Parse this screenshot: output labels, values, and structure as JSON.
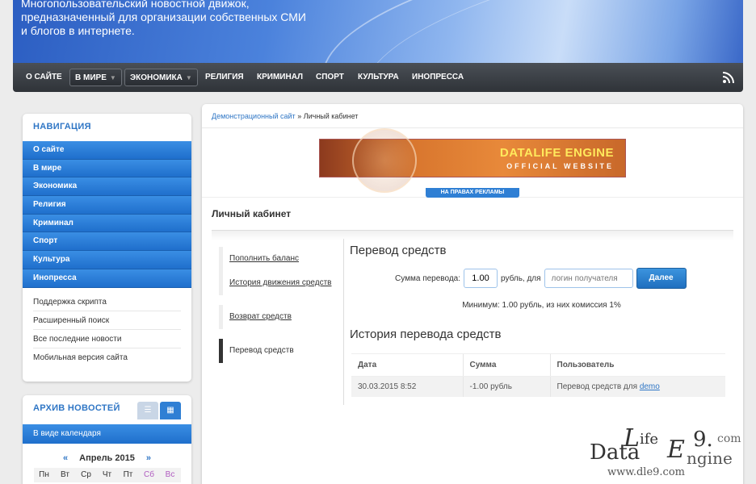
{
  "header": {
    "desc": "Многопользовательский новостной движок, предназначенный для организации собственных СМИ и блогов в интернете."
  },
  "topnav": {
    "items": [
      {
        "label": "О САЙТЕ"
      },
      {
        "label": "В МИРЕ"
      },
      {
        "label": "ЭКОНОМИКА"
      },
      {
        "label": "РЕЛИГИЯ"
      },
      {
        "label": "КРИМИНАЛ"
      },
      {
        "label": "СПОРТ"
      },
      {
        "label": "КУЛЬТУРА"
      },
      {
        "label": "ИНОПРЕССА"
      }
    ]
  },
  "nav_box": {
    "title": "НАВИГАЦИЯ",
    "blue_items": [
      "О сайте",
      "В мире",
      "Экономика",
      "Религия",
      "Криминал",
      "Спорт",
      "Культура",
      "Инопресса"
    ],
    "gray_items": [
      "Поддержка скрипта",
      "Расширенный поиск",
      "Все последние новости",
      "Мобильная версия сайта"
    ]
  },
  "archive_box": {
    "title": "АРХИВ НОВОСТЕЙ",
    "calendar_label": "В виде календаря",
    "month": "Апрель 2015",
    "prev": "«",
    "next": "»",
    "days": [
      "Пн",
      "Вт",
      "Ср",
      "Чт",
      "Пт",
      "Сб",
      "Вс"
    ]
  },
  "breadcrumb": {
    "home": "Демонстрационный сайт",
    "sep": " » ",
    "current": "Личный кабинет"
  },
  "banner": {
    "title": "DATALIFE ENGINE",
    "subtitle": "OFFICIAL WEBSITE",
    "ad_label": "НА ПРАВАХ РЕКЛАМЫ"
  },
  "page_title": "Личный кабинет",
  "cabinet_menu": {
    "group1": [
      "Пополнить баланс",
      "История движения средств"
    ],
    "group2": [
      "Возврат средств"
    ],
    "group3": [
      "Перевод средств"
    ]
  },
  "transfer": {
    "heading": "Перевод средств",
    "amount_label": "Сумма перевода:",
    "amount_value": "1.00",
    "currency_label": "рубль, для",
    "login_placeholder": "логин получателя",
    "submit_label": "Далее",
    "minimum_note": "Минимум: 1.00 рубль, из них комиссия 1%"
  },
  "history": {
    "heading": "История перевода средств",
    "columns": [
      "Дата",
      "Сумма",
      "Пользователь"
    ],
    "rows": [
      {
        "date": "30.03.2015 8:52",
        "amount": "-1.00 рубль",
        "user_prefix": "Перевод средств для",
        "user": "demo"
      }
    ]
  },
  "watermark": {
    "l": "L",
    "ife": "ife",
    "e": "E",
    "nine": "9.",
    "com": "com",
    "data": "Data",
    "ngine": "ngine",
    "url": "www.dle9.com"
  }
}
